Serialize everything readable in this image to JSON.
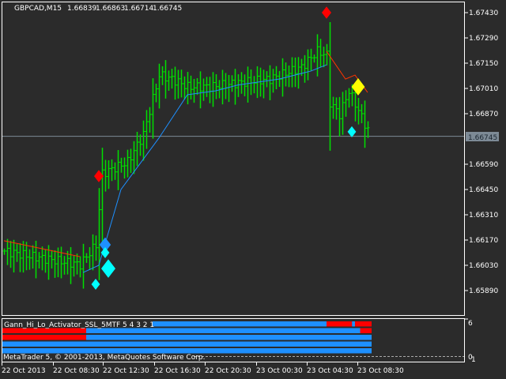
{
  "header": {
    "symbol": "GBPCAD,M15",
    "open": "1.66839",
    "high": "1.66863",
    "low": "1.66714",
    "close": "1.66745"
  },
  "colors": {
    "background": "#2b2b2b",
    "bars": "#00e000",
    "ma_up": "#1e90ff",
    "ma_down": "#ff3300",
    "grid": "#ffffff",
    "current": "#7d8a96"
  },
  "chart_data": {
    "type": "ohlc",
    "title": "GBPCAD,M15",
    "y_ticks": [
      "1.67430",
      "1.67290",
      "1.67150",
      "1.67010",
      "1.66870",
      "1.66590",
      "1.66450",
      "1.66310",
      "1.66170",
      "1.66030",
      "1.65890"
    ],
    "ylim": [
      1.6578,
      1.6748
    ],
    "current_price": "1.66745",
    "x_ticks": [
      "22 Oct 2013",
      "22 Oct 08:30",
      "22 Oct 12:30",
      "22 Oct 16:30",
      "22 Oct 20:30",
      "23 Oct 00:30",
      "23 Oct 04:30",
      "23 Oct 08:30"
    ],
    "bar_count": 116,
    "price_keypoints": [
      [
        0,
        1.66109
      ],
      [
        9,
        1.66078
      ],
      [
        24,
        1.66034
      ],
      [
        29,
        1.66144
      ],
      [
        31,
        1.66538
      ],
      [
        39,
        1.66603
      ],
      [
        44,
        1.66756
      ],
      [
        49,
        1.67084
      ],
      [
        53,
        1.67062
      ],
      [
        58,
        1.67019
      ],
      [
        65,
        1.67019
      ],
      [
        74,
        1.67041
      ],
      [
        84,
        1.67062
      ],
      [
        94,
        1.67128
      ],
      [
        99,
        1.67216
      ],
      [
        102,
        1.67195
      ],
      [
        103,
        1.66931
      ],
      [
        106,
        1.66866
      ],
      [
        109,
        1.66997
      ],
      [
        112,
        1.66888
      ],
      [
        115,
        1.66778
      ]
    ],
    "ma_red_1": [
      [
        0,
        1.66166
      ],
      [
        24,
        1.66078
      ]
    ],
    "ma_blue": [
      [
        25,
        1.6599
      ],
      [
        30,
        1.6603
      ],
      [
        37,
        1.6645
      ],
      [
        49,
        1.66735
      ],
      [
        58,
        1.66975
      ],
      [
        67,
        1.66997
      ],
      [
        74,
        1.67029
      ],
      [
        87,
        1.67062
      ],
      [
        97,
        1.67106
      ],
      [
        102,
        1.67141
      ]
    ],
    "ma_red_2": [
      [
        102,
        1.67216
      ],
      [
        108,
        1.67062
      ],
      [
        111,
        1.67084
      ],
      [
        115,
        1.66988
      ]
    ],
    "markers": [
      {
        "bar": 30,
        "price": 1.66524,
        "color": "#ff0000",
        "size": 1
      },
      {
        "bar": 102,
        "price": 1.6743,
        "color": "#ff0000",
        "size": 1
      },
      {
        "bar": 32,
        "price": 1.66144,
        "color": "#1e90ff",
        "size": 1.2
      },
      {
        "bar": 32,
        "price": 1.661,
        "color": "#00ffff",
        "size": 0.9
      },
      {
        "bar": 33,
        "price": 1.66012,
        "color": "#00ffff",
        "size": 1.5
      },
      {
        "bar": 29,
        "price": 1.65925,
        "color": "#00ffff",
        "size": 0.9
      },
      {
        "bar": 112,
        "price": 1.67019,
        "color": "#ffff00",
        "size": 1.4
      },
      {
        "bar": 110,
        "price": 1.6677,
        "color": "#00ffff",
        "size": 0.9
      }
    ]
  },
  "indicator": {
    "label": "Gann_Hi_Lo_Activator_SSL_5MTF 5 4 3 2 1",
    "y_max": "6",
    "y_min": "0",
    "y_min2": "1",
    "rows": [
      [
        [
          "#1e90ff",
          0.33,
          0.878
        ],
        [
          "#ff0000",
          0.878,
          0.947
        ],
        [
          "#1e90ff",
          0.947,
          0.955
        ],
        [
          "#ff0000",
          0.955,
          1
        ]
      ],
      [
        [
          "#ff0000",
          0,
          0.227
        ],
        [
          "#1e90ff",
          0.227,
          0.969
        ],
        [
          "#ff0000",
          0.969,
          1
        ]
      ],
      [
        [
          "#ff0000",
          0,
          0.227
        ],
        [
          "#1e90ff",
          0.227,
          1
        ]
      ],
      [
        [
          "#1e90ff",
          0,
          1
        ]
      ],
      [
        [
          "#1e90ff",
          0,
          1
        ]
      ]
    ]
  },
  "footer": {
    "copyright": "MetaTrader 5, © 2001-2013, MetaQuotes Software Corp."
  }
}
